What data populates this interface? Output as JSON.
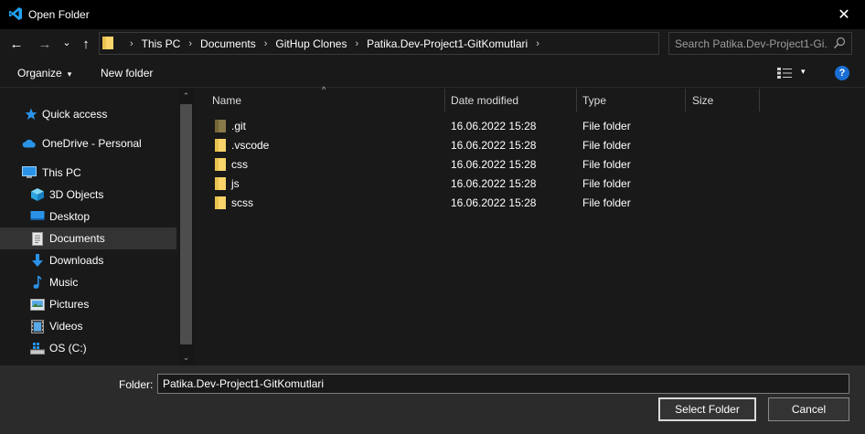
{
  "window": {
    "title": "Open Folder",
    "close_glyph": "✕"
  },
  "nav": {
    "back_glyph": "←",
    "forward_glyph": "→",
    "recent_glyph": "⌄",
    "up_glyph": "↑",
    "breadcrumbs": [
      "This PC",
      "Documents",
      "GitHup Clones",
      "Patika.Dev-Project1-GitKomutlari"
    ],
    "separator_glyph": "›",
    "dropdown_glyph": "⌄",
    "refresh_glyph": "↻"
  },
  "search": {
    "placeholder": "Search Patika.Dev-Project1-Gi..."
  },
  "toolbar": {
    "organize_label": "Organize",
    "organize_caret": "▾",
    "new_folder_label": "New folder",
    "view_caret": "▾",
    "help_glyph": "?"
  },
  "sidebar": {
    "items": [
      {
        "label": "Quick access",
        "icon": "star-icon"
      },
      {
        "label": "OneDrive - Personal",
        "icon": "cloud-icon"
      },
      {
        "label": "This PC",
        "icon": "computer-icon"
      },
      {
        "label": "3D Objects",
        "icon": "cube-icon"
      },
      {
        "label": "Desktop",
        "icon": "desktop-icon"
      },
      {
        "label": "Documents",
        "icon": "document-icon",
        "selected": true
      },
      {
        "label": "Downloads",
        "icon": "download-icon"
      },
      {
        "label": "Music",
        "icon": "music-icon"
      },
      {
        "label": "Pictures",
        "icon": "picture-icon"
      },
      {
        "label": "Videos",
        "icon": "video-icon"
      },
      {
        "label": "OS (C:)",
        "icon": "drive-icon"
      }
    ],
    "scroll_up_glyph": "⌃",
    "scroll_down_glyph": "⌄"
  },
  "file_list": {
    "sort_glyph": "^",
    "columns": [
      "Name",
      "Date modified",
      "Type",
      "Size"
    ],
    "rows": [
      {
        "name": ".git",
        "date": "16.06.2022 15:28",
        "type": "File folder",
        "size": "",
        "hidden": true
      },
      {
        "name": ".vscode",
        "date": "16.06.2022 15:28",
        "type": "File folder",
        "size": ""
      },
      {
        "name": "css",
        "date": "16.06.2022 15:28",
        "type": "File folder",
        "size": ""
      },
      {
        "name": "js",
        "date": "16.06.2022 15:28",
        "type": "File folder",
        "size": ""
      },
      {
        "name": "scss",
        "date": "16.06.2022 15:28",
        "type": "File folder",
        "size": ""
      }
    ]
  },
  "footer": {
    "folder_label": "Folder:",
    "folder_value": "Patika.Dev-Project1-GitKomutlari",
    "select_button": "Select Folder",
    "cancel_button": "Cancel"
  },
  "colors": {
    "folder_yellow": "#f8d46a",
    "folder_hidden": "#8a7a4a",
    "accent_blue": "#1a6fd4",
    "vscode_blue": "#22a1f0"
  }
}
